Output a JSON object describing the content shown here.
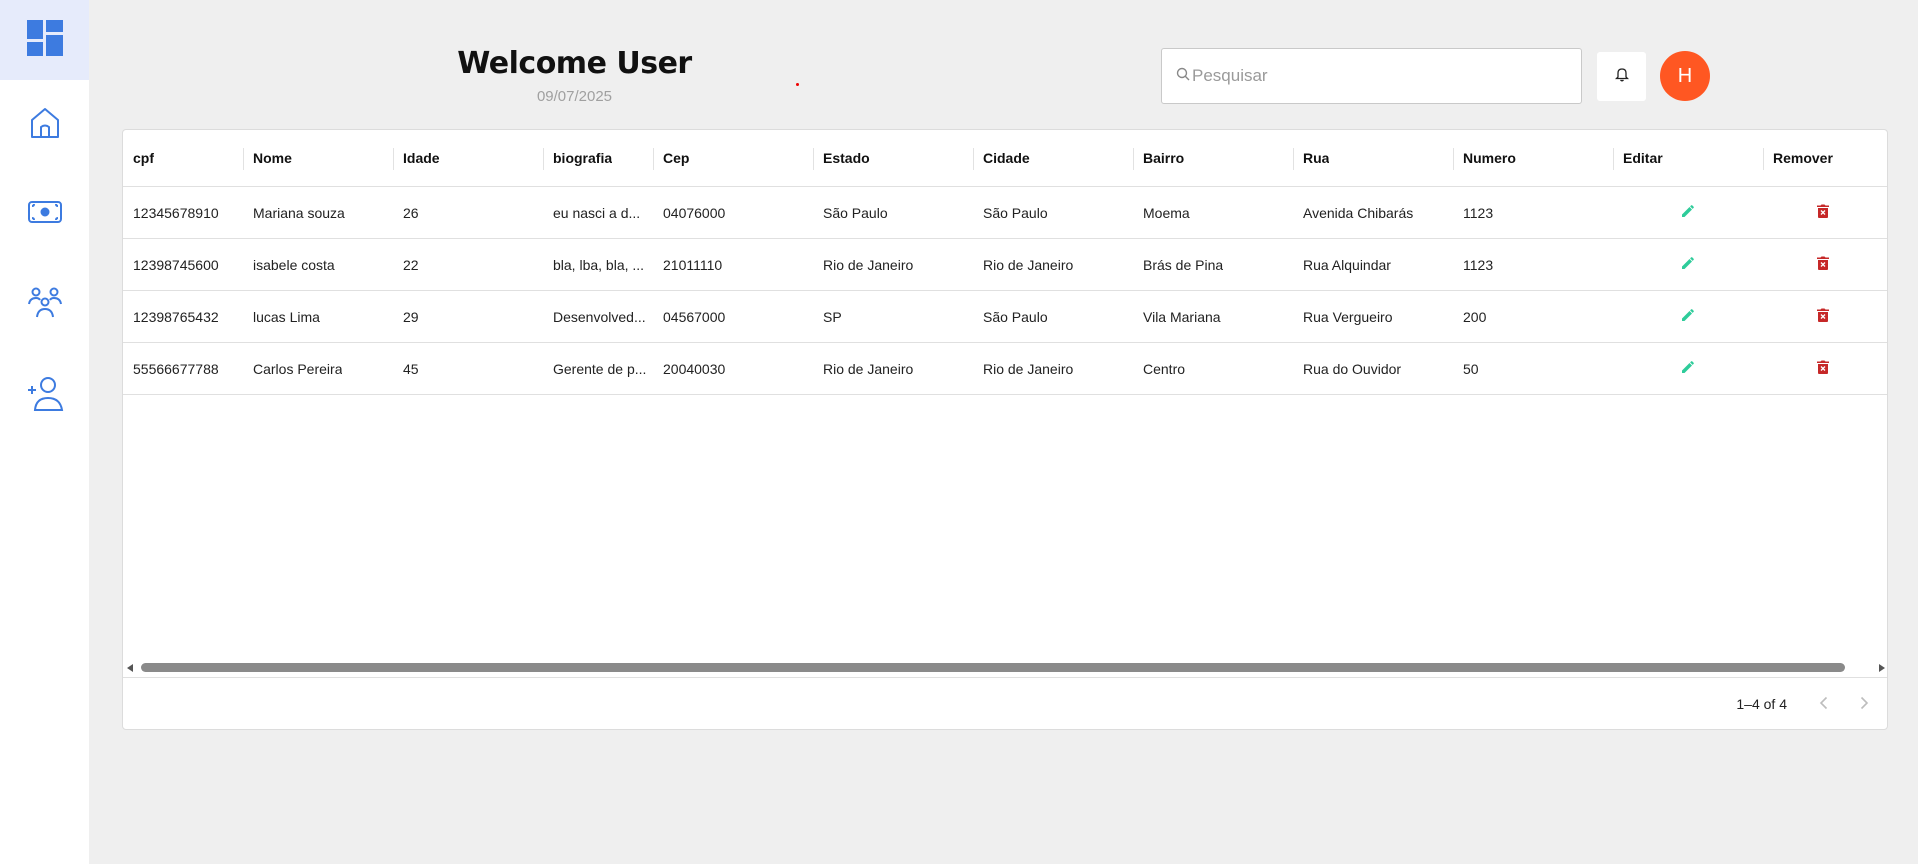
{
  "header": {
    "welcome": "Welcome User",
    "date": "09/07/2025"
  },
  "search": {
    "placeholder": "Pesquisar",
    "value": ""
  },
  "avatar": {
    "initial": "H",
    "color": "#ff5722"
  },
  "sidebar": {
    "items": [
      {
        "icon": "dashboard-icon"
      },
      {
        "icon": "home-icon"
      },
      {
        "icon": "money-icon"
      },
      {
        "icon": "users-group-icon"
      },
      {
        "icon": "add-user-icon"
      }
    ],
    "accent": "#3d7be0"
  },
  "table": {
    "columns": [
      "cpf",
      "Nome",
      "Idade",
      "biografia",
      "Cep",
      "Estado",
      "Cidade",
      "Bairro",
      "Rua",
      "Numero",
      "Editar",
      "Remover"
    ],
    "rows": [
      [
        "12345678910",
        "Mariana souza",
        "26",
        "eu nasci a d...",
        "04076000",
        "São Paulo",
        "São Paulo",
        "Moema",
        "Avenida Chibarás",
        "1123"
      ],
      [
        "12398745600",
        "isabele costa",
        "22",
        "bla, lba, bla, ...",
        "21011110",
        "Rio de Janeiro",
        "Rio de Janeiro",
        "Brás de Pina",
        "Rua Alquindar",
        "1123"
      ],
      [
        "12398765432",
        "lucas Lima",
        "29",
        "Desenvolved...",
        "04567000",
        "SP",
        "São Paulo",
        "Vila Mariana",
        "Rua Vergueiro",
        "200"
      ],
      [
        "55566677788",
        "Carlos Pereira",
        "45",
        "Gerente de p...",
        "20040030",
        "Rio de Janeiro",
        "Rio de Janeiro",
        "Centro",
        "Rua do Ouvidor",
        "50"
      ]
    ],
    "edit_color": "#2ecc9a",
    "delete_color": "#c62828"
  },
  "pagination": {
    "label": "1–4 of 4"
  }
}
